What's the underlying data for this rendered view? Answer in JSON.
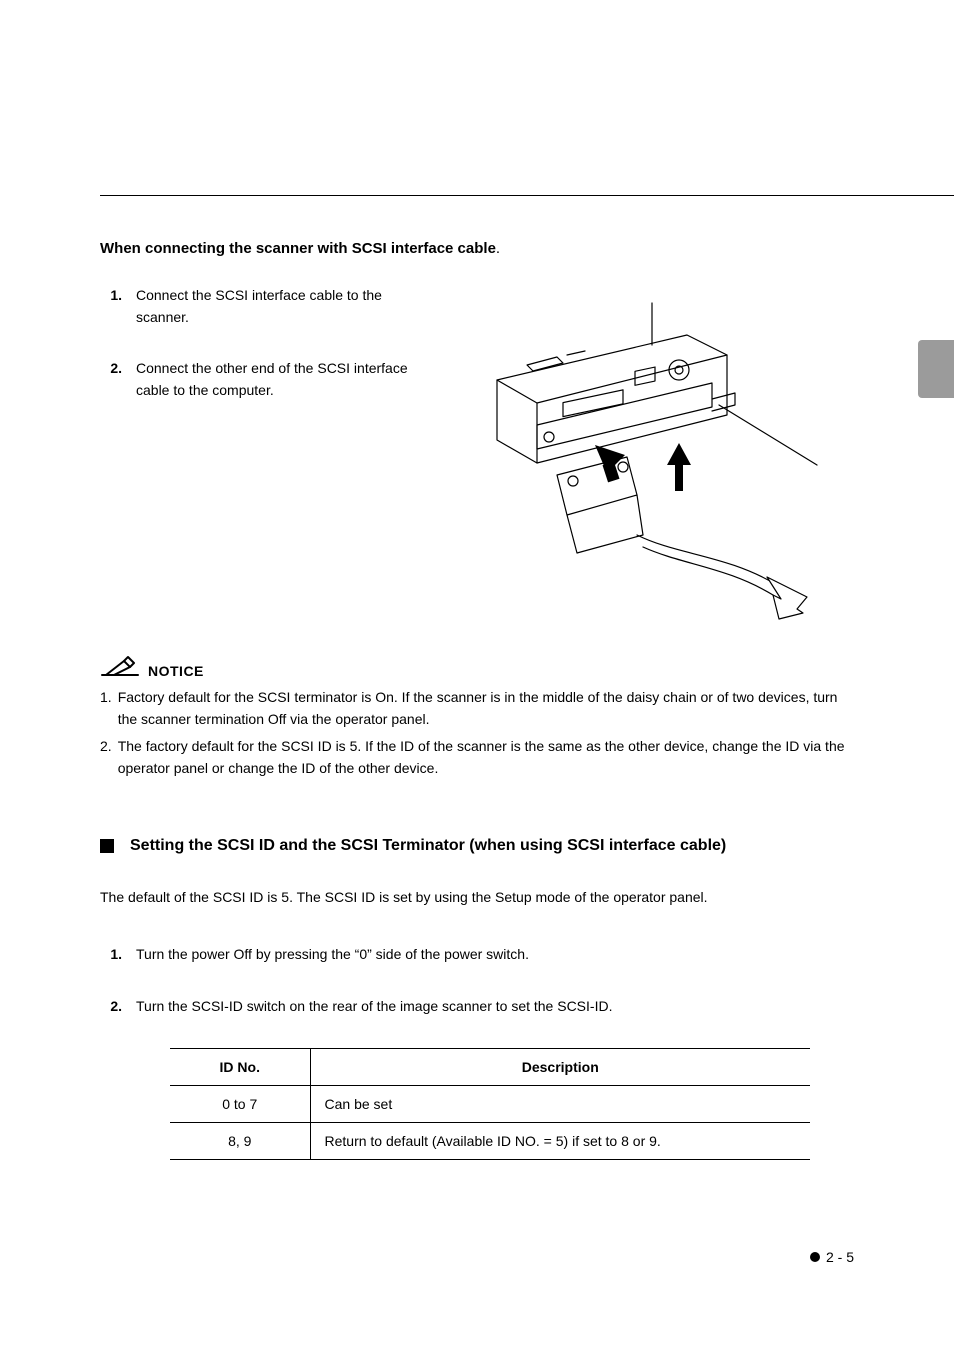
{
  "section1": {
    "heading": "When connecting the scanner with SCSI interface cable",
    "heading_suffix": ".",
    "steps": [
      {
        "num": "1.",
        "text": "Connect the SCSI interface cable to the scanner."
      },
      {
        "num": "2.",
        "text": "Connect the other end of the SCSI interface cable to the computer."
      }
    ]
  },
  "notice": {
    "label": "NOTICE",
    "items": [
      {
        "n": "1.",
        "text": "Factory default for the SCSI terminator is On. If the scanner is in the middle of the daisy chain or of two devices, turn the scanner termination Off via the operator panel."
      },
      {
        "n": "2.",
        "text": "The factory default for the SCSI ID is 5. If the ID of the scanner is the same as the other device, change the ID via the operator panel or change the ID of the other device."
      }
    ]
  },
  "section2": {
    "title": "Setting the SCSI ID and the SCSI Terminator (when using SCSI interface cable)",
    "intro": "The default of the SCSI ID is 5. The SCSI ID is set by using the Setup mode of the operator panel.",
    "steps": [
      {
        "num": "1.",
        "text": "Turn the power Off by pressing the “0” side of the power switch."
      },
      {
        "num": "2.",
        "text": "Turn the SCSI-ID switch on the rear of the image scanner to set the SCSI-ID."
      }
    ],
    "table": {
      "headers": [
        "ID No.",
        "Description"
      ],
      "rows": [
        {
          "id": "0 to 7",
          "desc": "Can be set"
        },
        {
          "id": "8, 9",
          "desc": "Return to default (Available ID NO. = 5) if set to 8 or 9."
        }
      ]
    }
  },
  "footer": {
    "page": "2 - 5"
  }
}
